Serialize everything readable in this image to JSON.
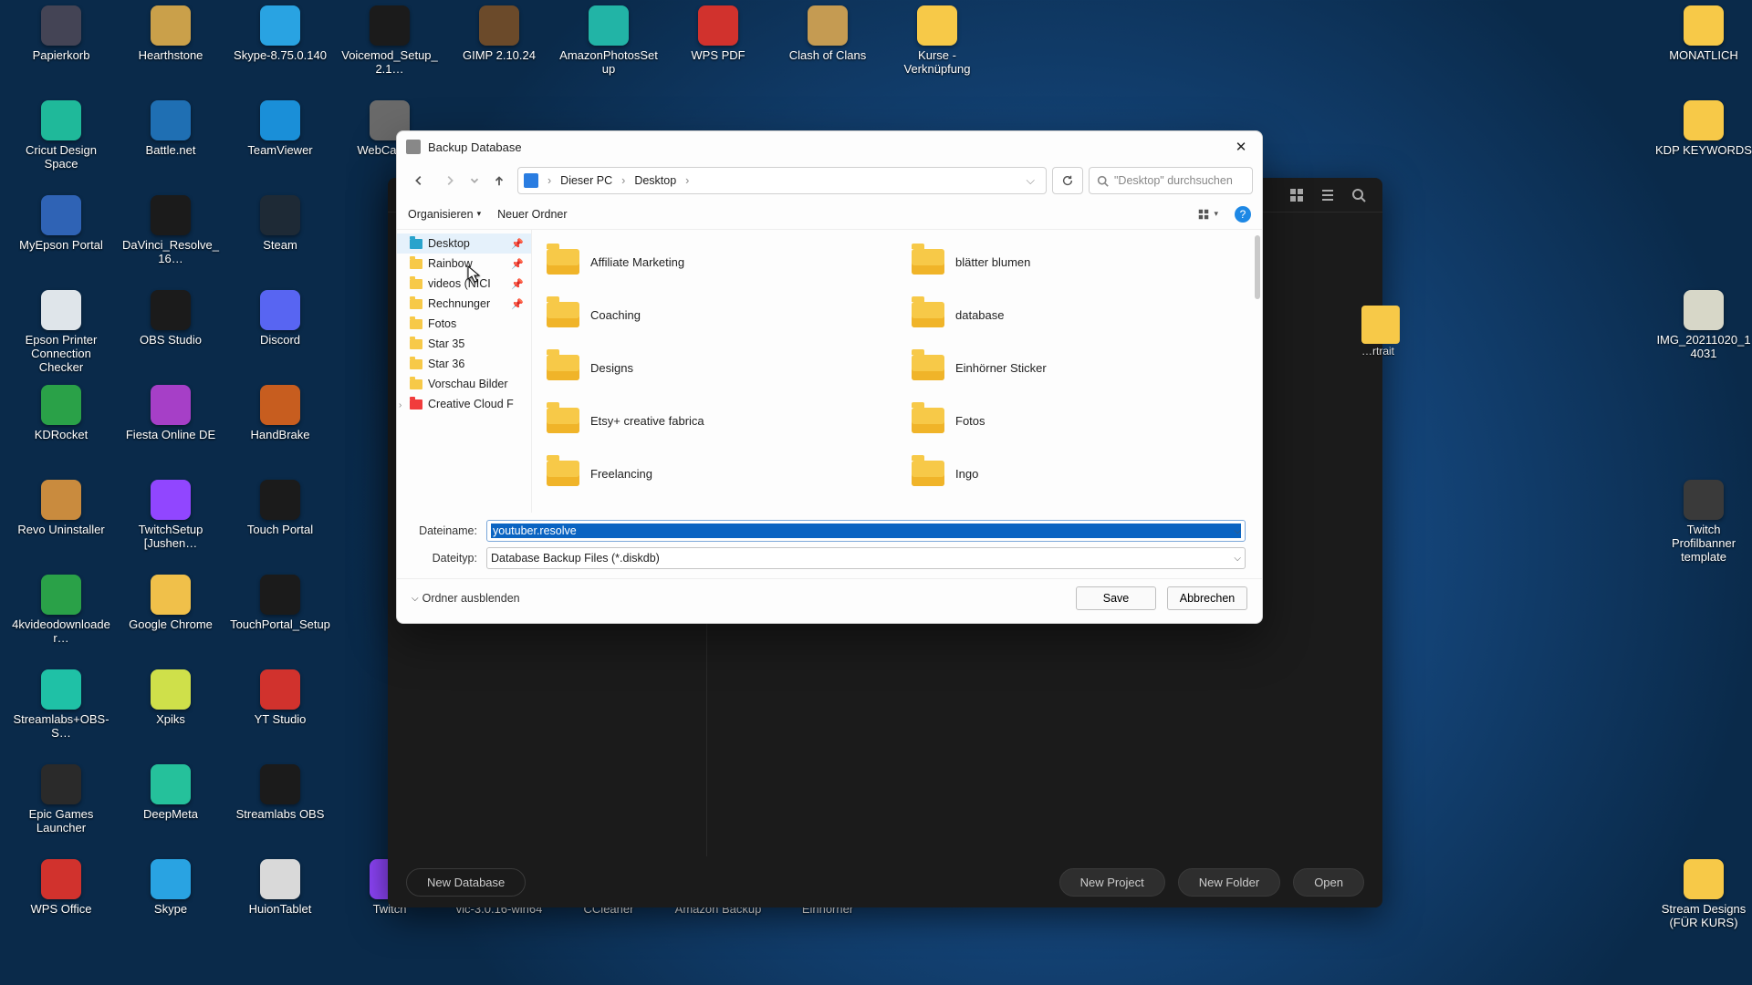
{
  "desktop_icons": [
    [
      "Papierkorb",
      "#445"
    ],
    [
      "Hearthstone",
      "#caa04a"
    ],
    [
      "Skype-8.75.0.140",
      "#29a3e2"
    ],
    [
      "Voicemod_Setup_2.1…",
      "#1b1b1b"
    ],
    [
      "GIMP 2.10.24",
      "#6b4a2a"
    ],
    [
      "AmazonPhotosSetup",
      "#22b4a6"
    ],
    [
      "WPS PDF",
      "#d1322d"
    ],
    [
      "Clash of Clans",
      "#c59b52"
    ],
    [
      "Kurse - Verknüpfung",
      "#f7c948"
    ],
    [
      "",
      "#0000"
    ],
    [
      "",
      "#0000"
    ],
    [
      "",
      "#0000"
    ],
    [
      "",
      "#0000"
    ],
    [
      "",
      "#0000"
    ],
    [
      "",
      "#0000"
    ],
    [
      "MONATLICH",
      "#f7c948"
    ],
    [
      "Cricut Design Space",
      "#1fb99a"
    ],
    [
      "Battle.net",
      "#1f6fb3"
    ],
    [
      "TeamViewer",
      "#1a8fd8"
    ],
    [
      "WebCatalog",
      "#6a6a6a"
    ],
    [
      "",
      "#0000"
    ],
    [
      "",
      "#0000"
    ],
    [
      "",
      "#0000"
    ],
    [
      "",
      "#0000"
    ],
    [
      "",
      "#0000"
    ],
    [
      "",
      "#0000"
    ],
    [
      "",
      "#0000"
    ],
    [
      "",
      "#0000"
    ],
    [
      "",
      "#0000"
    ],
    [
      "",
      "#0000"
    ],
    [
      "",
      "#0000"
    ],
    [
      "KDP KEYWORDS",
      "#f7c948"
    ],
    [
      "MyEpson Portal",
      "#2f63b5"
    ],
    [
      "DaVinci_Resolve_16…",
      "#1b1b1b"
    ],
    [
      "Steam",
      "#1e2a36"
    ],
    [
      "",
      "#0000"
    ],
    [
      "",
      "#0000"
    ],
    [
      "",
      "#0000"
    ],
    [
      "",
      "#0000"
    ],
    [
      "",
      "#0000"
    ],
    [
      "",
      "#0000"
    ],
    [
      "",
      "#0000"
    ],
    [
      "",
      "#0000"
    ],
    [
      "",
      "#0000"
    ],
    [
      "",
      "#0000"
    ],
    [
      "",
      "#0000"
    ],
    [
      "",
      "#0000"
    ],
    [
      "",
      "#0000"
    ],
    [
      "Epson Printer Connection Checker",
      "#dfe5ea"
    ],
    [
      "OBS Studio",
      "#1b1b1b"
    ],
    [
      "Discord",
      "#5865f2"
    ],
    [
      "",
      "#0000"
    ],
    [
      "",
      "#0000"
    ],
    [
      "",
      "#0000"
    ],
    [
      "",
      "#0000"
    ],
    [
      "",
      "#0000"
    ],
    [
      "",
      "#0000"
    ],
    [
      "",
      "#0000"
    ],
    [
      "",
      "#0000"
    ],
    [
      "",
      "#0000"
    ],
    [
      "",
      "#0000"
    ],
    [
      "",
      "#0000"
    ],
    [
      "",
      "#0000"
    ],
    [
      "IMG_20211020_14031",
      "#d7d7c8"
    ],
    [
      "KDRocket",
      "#2aa148"
    ],
    [
      "Fiesta Online DE",
      "#a63fc7"
    ],
    [
      "HandBrake",
      "#c75d1f"
    ],
    [
      "",
      "#0000"
    ],
    [
      "",
      "#0000"
    ],
    [
      "",
      "#0000"
    ],
    [
      "",
      "#0000"
    ],
    [
      "",
      "#0000"
    ],
    [
      "",
      "#0000"
    ],
    [
      "",
      "#0000"
    ],
    [
      "",
      "#0000"
    ],
    [
      "",
      "#0000"
    ],
    [
      "",
      "#0000"
    ],
    [
      "",
      "#0000"
    ],
    [
      "",
      "#0000"
    ],
    [
      "",
      "#0000"
    ],
    [
      "Revo Uninstaller",
      "#c98b3e"
    ],
    [
      "TwitchSetup [Jushen…",
      "#9146ff"
    ],
    [
      "Touch Portal",
      "#1b1b1b"
    ],
    [
      "",
      "#0000"
    ],
    [
      "",
      "#0000"
    ],
    [
      "",
      "#0000"
    ],
    [
      "",
      "#0000"
    ],
    [
      "",
      "#0000"
    ],
    [
      "",
      "#0000"
    ],
    [
      "",
      "#0000"
    ],
    [
      "",
      "#0000"
    ],
    [
      "",
      "#0000"
    ],
    [
      "",
      "#0000"
    ],
    [
      "",
      "#0000"
    ],
    [
      "",
      "#0000"
    ],
    [
      "Twitch Profilbanner template",
      "#3a3a3a"
    ],
    [
      "4kvideodownloader…",
      "#2aa148"
    ],
    [
      "Google Chrome",
      "#f0c04a"
    ],
    [
      "TouchPortal_Setup",
      "#1b1b1b"
    ],
    [
      "",
      "#0000"
    ],
    [
      "",
      "#0000"
    ],
    [
      "",
      "#0000"
    ],
    [
      "",
      "#0000"
    ],
    [
      "",
      "#0000"
    ],
    [
      "",
      "#0000"
    ],
    [
      "",
      "#0000"
    ],
    [
      "",
      "#0000"
    ],
    [
      "",
      "#0000"
    ],
    [
      "",
      "#0000"
    ],
    [
      "",
      "#0000"
    ],
    [
      "",
      "#0000"
    ],
    [
      "",
      "#0000"
    ],
    [
      "Streamlabs+OBS-S…",
      "#1fc1a6"
    ],
    [
      "Xpiks",
      "#cfe04a"
    ],
    [
      "YT Studio",
      "#d1322d"
    ],
    [
      "",
      "#0000"
    ],
    [
      "",
      "#0000"
    ],
    [
      "",
      "#0000"
    ],
    [
      "",
      "#0000"
    ],
    [
      "",
      "#0000"
    ],
    [
      "",
      "#0000"
    ],
    [
      "",
      "#0000"
    ],
    [
      "",
      "#0000"
    ],
    [
      "",
      "#0000"
    ],
    [
      "",
      "#0000"
    ],
    [
      "",
      "#0000"
    ],
    [
      "",
      "#0000"
    ],
    [
      "",
      "#0000"
    ],
    [
      "Epic Games Launcher",
      "#2a2a2a"
    ],
    [
      "DeepMeta",
      "#25c19b"
    ],
    [
      "Streamlabs OBS",
      "#1b1b1b"
    ],
    [
      "",
      "#0000"
    ],
    [
      "",
      "#0000"
    ],
    [
      "",
      "#0000"
    ],
    [
      "",
      "#0000"
    ],
    [
      "",
      "#0000"
    ],
    [
      "",
      "#0000"
    ],
    [
      "",
      "#0000"
    ],
    [
      "",
      "#0000"
    ],
    [
      "",
      "#0000"
    ],
    [
      "",
      "#0000"
    ],
    [
      "",
      "#0000"
    ],
    [
      "",
      "#0000"
    ],
    [
      "",
      "#0000"
    ],
    [
      "WPS Office",
      "#d1322d"
    ],
    [
      "Skype",
      "#29a3e2"
    ],
    [
      "HuionTablet",
      "#d9d9d9"
    ],
    [
      "Twitch",
      "#9146ff"
    ],
    [
      "vlc-3.0.16-win64",
      "#e57f1f"
    ],
    [
      "CCleaner",
      "#3a74c4"
    ],
    [
      "Amazon Backup",
      "#f7c948"
    ],
    [
      "Einhörner",
      "#f7c948"
    ],
    [
      "",
      "#0000"
    ],
    [
      "",
      "#0000"
    ],
    [
      "",
      "#0000"
    ],
    [
      "",
      "#0000"
    ],
    [
      "",
      "#0000"
    ],
    [
      "",
      "#0000"
    ],
    [
      "",
      "#0000"
    ],
    [
      "Stream Designs (FÜR KURS)",
      "#f7c948"
    ]
  ],
  "pm": {
    "grid_ic": "grid",
    "list_ic": "list",
    "search_ic": "search",
    "buttons": {
      "newdb": "New Database",
      "newproj": "New Project",
      "newfolder": "New Folder",
      "open": "Open"
    },
    "side_hint": "…rtrait"
  },
  "dialog": {
    "title": "Backup Database",
    "breadcrumb": [
      "Dieser PC",
      "Desktop"
    ],
    "search_placeholder": "\"Desktop\" durchsuchen",
    "toolbar": {
      "organize": "Organisieren",
      "newfolder": "Neuer Ordner",
      "help": "?"
    },
    "tree": [
      {
        "label": "Desktop",
        "icon": "desktop",
        "pinned": true,
        "selected": true
      },
      {
        "label": "Rainbow",
        "icon": "folder",
        "pinned": true
      },
      {
        "label": "videos (NICI",
        "icon": "folder",
        "pinned": true
      },
      {
        "label": "Rechnunger",
        "icon": "folder",
        "pinned": true
      },
      {
        "label": "Fotos",
        "icon": "folder"
      },
      {
        "label": "Star 35",
        "icon": "folder"
      },
      {
        "label": "Star 36",
        "icon": "folder"
      },
      {
        "label": "Vorschau Bilder",
        "icon": "folder"
      },
      {
        "label": "Creative Cloud F",
        "icon": "cc",
        "caret": true
      }
    ],
    "folders_left": [
      "Affiliate Marketing",
      "Coaching",
      "Designs",
      "Etsy+ creative fabrica",
      "Freelancing"
    ],
    "folders_right": [
      "blätter blumen",
      "database",
      "Einhörner Sticker",
      "Fotos",
      "Ingo"
    ],
    "filename_label": "Dateiname:",
    "filename_value": "youtuber.resolve",
    "filetype_label": "Dateityp:",
    "filetype_value": "Database Backup Files (*.diskdb)",
    "hide_folders": "Ordner ausblenden",
    "save": "Save",
    "cancel": "Abbrechen"
  }
}
